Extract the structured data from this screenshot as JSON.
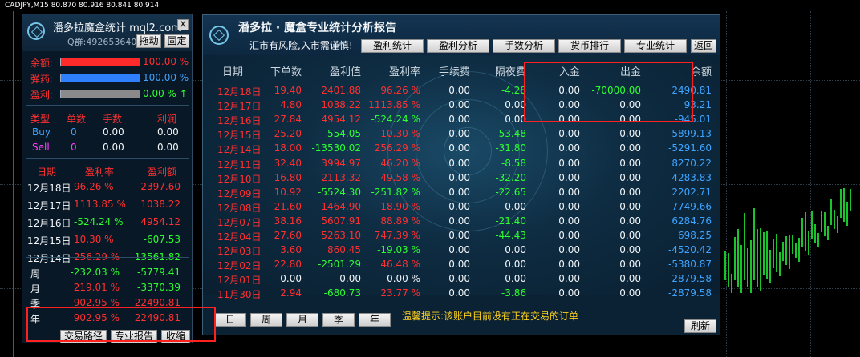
{
  "chart": {
    "title": "CADJPY,M15  80.870 80.916 80.841 80.914"
  },
  "left_panel": {
    "title": "潘多拉魔盒统计 mql2.com",
    "close": "X",
    "qq": "Q群:492653640",
    "drag_button": "拖动",
    "fix_button": "固定",
    "stats": [
      {
        "label": "余额:",
        "value": "100.00 %",
        "color": "#ff2a2a",
        "fill": 1.0
      },
      {
        "label": "弹药:",
        "value": "100.00 %",
        "color": "#2f80ff",
        "fill": 1.0
      },
      {
        "label": "盈利:",
        "value": "0.00 % ↑",
        "color": "#8a8a8a",
        "fill": 1.0
      }
    ],
    "pos_headers": [
      "类型",
      "单数",
      "手数",
      "利润"
    ],
    "positions": [
      {
        "type": "Buy",
        "count": "0",
        "lots": "0.00",
        "profit": "0.00"
      },
      {
        "type": "Sell",
        "count": "0",
        "lots": "0.00",
        "profit": "0.00"
      }
    ],
    "day_headers": [
      "日期",
      "盈利率",
      "盈利额"
    ],
    "days": [
      {
        "date": "12月18日",
        "rate": "96.26 %",
        "amount": "2397.60"
      },
      {
        "date": "12月17日",
        "rate": "1113.85 %",
        "amount": "1038.22"
      },
      {
        "date": "12月16日",
        "rate": "-524.24 %",
        "amount": "4954.12"
      },
      {
        "date": "12月15日",
        "rate": "10.30 %",
        "amount": "-607.53"
      },
      {
        "date": "12月14日",
        "rate": "256.29 %",
        "amount": "-13561.82"
      }
    ],
    "periods": [
      {
        "label": "周",
        "rate": "-232.03 %",
        "amount": "-5779.41"
      },
      {
        "label": "月",
        "rate": "219.01 %",
        "amount": "-3370.39"
      },
      {
        "label": "季",
        "rate": "902.95 %",
        "amount": "22490.81"
      },
      {
        "label": "年",
        "rate": "902.95 %",
        "amount": "22490.81"
      }
    ],
    "buttons": [
      "交易路径",
      "专业报告",
      "收缩"
    ]
  },
  "right_panel": {
    "title": "潘多拉 · 魔盒专业统计分析报告",
    "warning": "汇市有风险,入市需谨慎!",
    "tabs": [
      "盈利统计",
      "盈利分析",
      "手数分析",
      "货币排行",
      "专业统计"
    ],
    "back": "返回",
    "headers": [
      "日期",
      "下单数",
      "盈利值",
      "盈利率",
      "手续费",
      "隔夜费",
      "入金",
      "出金",
      "余额"
    ],
    "rows": [
      [
        "12月18日",
        "19.40",
        "2401.88",
        "96.26 %",
        "0.00",
        "-4.28",
        "0.00",
        "-70000.00",
        "2490.81"
      ],
      [
        "12月17日",
        "4.80",
        "1038.22",
        "1113.85 %",
        "0.00",
        "0.00",
        "0.00",
        "0.00",
        "93.21"
      ],
      [
        "12月16日",
        "27.84",
        "4954.12",
        "-524.24 %",
        "0.00",
        "0.00",
        "0.00",
        "0.00",
        "-945.01"
      ],
      [
        "12月15日",
        "25.20",
        "-554.05",
        "10.30 %",
        "0.00",
        "-53.48",
        "0.00",
        "0.00",
        "-5899.13"
      ],
      [
        "12月14日",
        "18.00",
        "-13530.02",
        "256.29 %",
        "0.00",
        "-31.80",
        "0.00",
        "0.00",
        "-5291.60"
      ],
      [
        "12月11日",
        "32.40",
        "3994.97",
        "46.20 %",
        "0.00",
        "-8.58",
        "0.00",
        "0.00",
        "8270.22"
      ],
      [
        "12月10日",
        "16.80",
        "2113.32",
        "49.58 %",
        "0.00",
        "-32.20",
        "0.00",
        "0.00",
        "4283.83"
      ],
      [
        "12月09日",
        "10.92",
        "-5524.30",
        "-251.82 %",
        "0.00",
        "-22.65",
        "0.00",
        "0.00",
        "2202.71"
      ],
      [
        "12月08日",
        "21.60",
        "1464.90",
        "18.90 %",
        "0.00",
        "0.00",
        "0.00",
        "0.00",
        "7749.66"
      ],
      [
        "12月07日",
        "38.16",
        "5607.91",
        "88.89 %",
        "0.00",
        "-21.40",
        "0.00",
        "0.00",
        "6284.76"
      ],
      [
        "12月04日",
        "27.60",
        "5263.10",
        "747.39 %",
        "0.00",
        "-44.43",
        "0.00",
        "0.00",
        "698.25"
      ],
      [
        "12月03日",
        "3.60",
        "860.45",
        "-19.03 %",
        "0.00",
        "0.00",
        "0.00",
        "0.00",
        "-4520.42"
      ],
      [
        "12月02日",
        "22.80",
        "-2501.29",
        "46.48 %",
        "0.00",
        "0.00",
        "0.00",
        "0.00",
        "-5380.87"
      ],
      [
        "12月01日",
        "0.00",
        "0.00",
        "0.00 %",
        "0.00",
        "0.00",
        "0.00",
        "0.00",
        "-2879.58"
      ],
      [
        "11月30日",
        "2.94",
        "-680.73",
        "23.77 %",
        "0.00",
        "-3.86",
        "0.00",
        "0.00",
        "-2879.58"
      ]
    ],
    "period_buttons": [
      "日",
      "周",
      "月",
      "季",
      "年"
    ],
    "hint": "温馨提示:该账户目前没有正在交易的订单",
    "refresh": "刷新"
  },
  "colors": {
    "profit": "#ff3030",
    "loss": "#2dff30",
    "balance": "#3ea4ff",
    "highlight": "#ff2020"
  }
}
